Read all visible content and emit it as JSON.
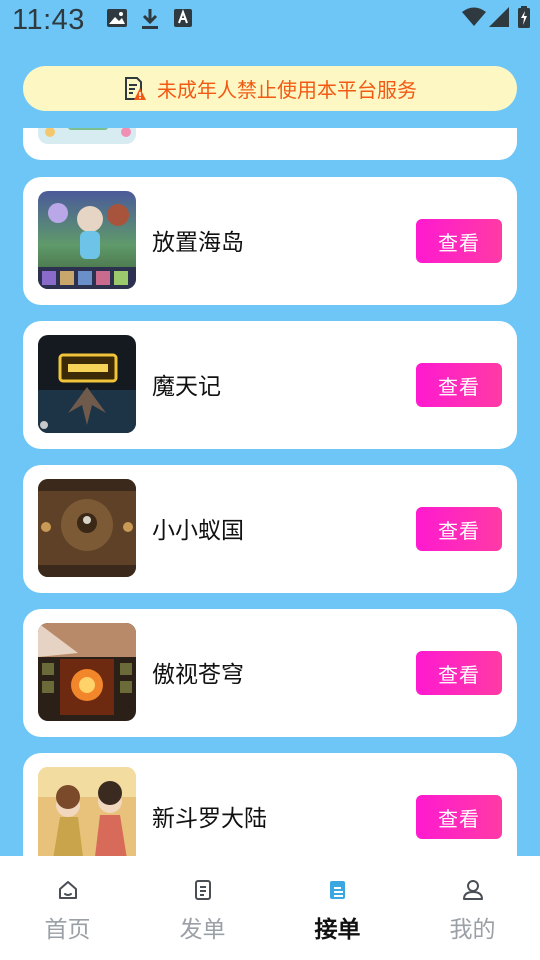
{
  "status_bar": {
    "time": "11:43",
    "left_icons": [
      "image-icon",
      "download-icon",
      "font-icon"
    ],
    "right_icons": [
      "wifi-icon",
      "signal-icon",
      "battery-icon"
    ]
  },
  "notice": {
    "text": "未成年人禁止使用本平台服务",
    "icon": "document-warning-icon",
    "color": "#f25a14"
  },
  "games": [
    {
      "name": "放置海岛",
      "button": "查看"
    },
    {
      "name": "魔天记",
      "button": "查看"
    },
    {
      "name": "小小蚁国",
      "button": "查看"
    },
    {
      "name": "傲视苍穹",
      "button": "查看"
    },
    {
      "name": "新斗罗大陆",
      "button": "查看"
    }
  ],
  "tabs": [
    {
      "label": "首页",
      "icon": "home-icon",
      "active": false
    },
    {
      "label": "发单",
      "icon": "order-doc-icon",
      "active": false
    },
    {
      "label": "接单",
      "icon": "receive-order-icon",
      "active": true
    },
    {
      "label": "我的",
      "icon": "user-icon",
      "active": false
    }
  ],
  "colors": {
    "background": "#6ec6f7",
    "button_gradient_start": "#ff1ad0",
    "button_gradient_end": "#ff3aa5",
    "notice_bg": "#fdf7c4",
    "active_tab_icon": "#3aa7e0"
  }
}
